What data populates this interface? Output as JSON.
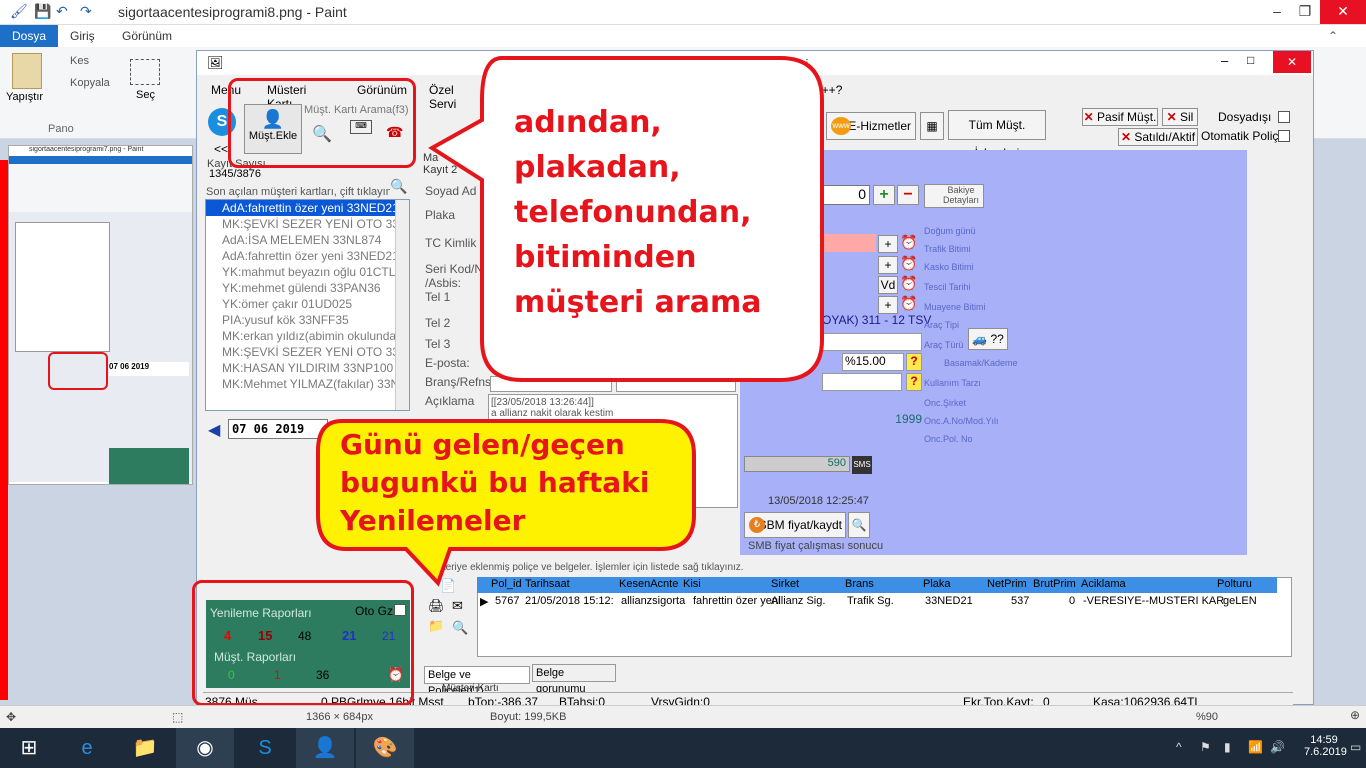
{
  "paint": {
    "title": "sigortaacentesiprogrami8.png - Paint",
    "tabs": [
      "Dosya",
      "Giriş",
      "Görünüm"
    ],
    "clipboard": {
      "paste": "Yapıştır",
      "cut": "Kes",
      "copy": "Kopyala",
      "group": "Pano"
    },
    "select": "Seç",
    "status_size": "1366 × 684px",
    "status_file": "Boyut: 199,5KB",
    "zoom": "%90"
  },
  "thumb": {
    "title": "sigortaacentesiprogrami7.png - Paint",
    "date": "07 06 2019",
    "day": "Cuma"
  },
  "app": {
    "title": "şteri",
    "menu": [
      "Menu",
      "Müsteri Kartı",
      "Görünüm",
      "Özel Servi"
    ],
    "menu_tail": "n++?",
    "toolbar": {
      "add": "Müşt.Ekle",
      "search_label": "Müşt. Kartı Arama(f3)",
      "back": "<<"
    },
    "record_label": "Kayıt Sayısı",
    "record_count": "1345/3876",
    "recent_label": "Son açılan müşteri kartları, çift tıklayınız",
    "list": [
      "AdA:fahrettin özer yeni 33NED21",
      "MK:ŞEVKİ SEZER YENİ OTO 33N",
      "AdA:İSA MELEMEN 33NL874",
      "AdA:fahrettin özer yeni 33NED21",
      "YK:mahmut beyazın oğlu 01CTL06",
      "YK:mehmet gülendi 33PAN36",
      "YK:ömer çakır 01UD025",
      "PIA:yusuf kök 33NFF35",
      "MK:erkan yıldız(abimin okulundan) 3",
      "MK:ŞEVKİ SEZER YENİ OTO 33N",
      "MK:HASAN YILDIRIM 33NP100",
      "MK:Mehmet YILMAZ(fakılar) 33NRV"
    ],
    "date": "07 06 2019",
    "form_labels": [
      "Soyad Ad",
      "Plaka",
      "TC Kimlik n",
      "Seri Kod/N",
      "/Asbis:",
      "Tel 1",
      "Tel 2",
      "Tel 3",
      "E-posta:",
      "Branş/Refns",
      "Açıklama"
    ],
    "form_top": [
      "Ma",
      "Kayıt 2"
    ],
    "aciklama_text": "[[23/05/2018 13:26:44]]",
    "aciklama_text2": "a allianz nakit olarak kestim",
    "buttons": {
      "ehizmetler": "E-Hizmetler",
      "tum": "Tüm Müşt. İşlemleri",
      "pasif": "Pasif Müşt.",
      "sil": "Sil",
      "satildi": "Satıldı/Aktif",
      "dosya": "Dosyadışı",
      "otomatik": "Otomatik Poliçe",
      "bakiye": "Bakiye Detayları",
      "sbm": "SBM fiyat/kaydt",
      "vd": "Vd"
    },
    "balance": "0",
    "side_labels": [
      "Doğum günü",
      "Trafik Bitimi",
      "Kasko Bitimi",
      "Tescil Tarihi",
      "Muayene Bitimi",
      "Araç Tipi",
      "Araç Türü",
      "Basamak/Kademe",
      "Kullanım Tarzı",
      "Onc.Şirket",
      "Onc.A.No/Mod.Yılı",
      "Onc.Pol. No"
    ],
    "insurer": "OYAK) 311 - 12 TSV",
    "percent": "%15.00",
    "year": "1999",
    "amount": "590",
    "stamp": "13/05/2018 12:25:47",
    "smb_note": "SMB fiyat çalışması sonucu",
    "grid_hint": "Müşteriye eklenmiş poliçe ve belgeler. İşlemler için listede sağ tıklayınız.",
    "grid_cols": [
      "Pol_id",
      "Tarihsaat",
      "KesenAcnte",
      "Kisi",
      "Sirket",
      "Brans",
      "Plaka",
      "NetPrim",
      "BrutPrim",
      "Aciklama",
      "Polturu"
    ],
    "grid_row": [
      "5767",
      "21/05/2018 15:12:",
      "allianzsigorta",
      "fahrettin özer yeni",
      "Allianz Sig.",
      "Trafik Sg.",
      "33NED21",
      "537",
      "0",
      "-VERESIYE--MUSTERI KAR",
      "geLEN"
    ],
    "tabs": [
      "Belge ve Poliçeler(1)",
      "Belge gorunumu"
    ],
    "green": {
      "title": "Yenileme Raporları",
      "otogz": "Oto Gz",
      "r1": [
        "4",
        "15",
        "48",
        "21",
        "21"
      ],
      "sub": "Müşt. Raporları",
      "r2": [
        "0",
        "1",
        "36"
      ]
    },
    "status": [
      "3876 Müş",
      "0 PBGrlmye 16bit Mşst",
      "bTop:-386,37",
      "BTahsi:0",
      "VrsyGidn:0",
      "Ekr.Top.Kayt:",
      "0",
      "Kasa:1062936,64TL"
    ],
    "bottom_tabs": [
      "Müsteri Kartı"
    ]
  },
  "callouts": {
    "search": [
      "adından,",
      "plakadan,",
      "telefonundan,",
      "bitiminden",
      "müşteri arama"
    ],
    "renew": [
      "Günü gelen/geçen",
      "bugunkü bu haftaki",
      "Yenilemeler"
    ]
  },
  "taskbar": {
    "time": "14:59",
    "date": "7.6.2019"
  },
  "colors": {
    "red": "#e5151b",
    "yellow": "#fff200",
    "selection": "#0a58d6",
    "panel": "#a8b0f8",
    "green": "#2e7c60"
  }
}
